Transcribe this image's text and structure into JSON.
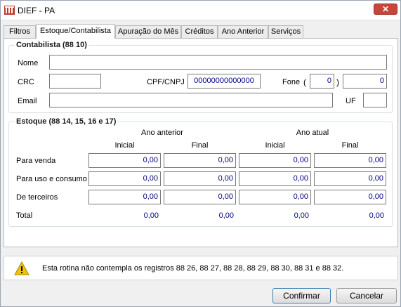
{
  "window": {
    "title": "DIEF - PA",
    "close_label": "✕"
  },
  "tabs": [
    {
      "label": "Filtros"
    },
    {
      "label": "Estoque/Contabilista"
    },
    {
      "label": "Apuração do Mês"
    },
    {
      "label": "Créditos"
    },
    {
      "label": "Ano Anterior"
    },
    {
      "label": "Serviços"
    }
  ],
  "active_tab": "Estoque/Contabilista",
  "contabilista": {
    "title": "Contabilista (88 10)",
    "nome_label": "Nome",
    "nome_value": "",
    "crc_label": "CRC",
    "crc_value": "",
    "cpf_label": "CPF/CNPJ",
    "cpf_value": "00000000000000",
    "fone_label": "Fone",
    "paren_open": "(",
    "paren_close": ")",
    "ddd_value": "0",
    "fone_value": "0",
    "email_label": "Email",
    "email_value": "",
    "uf_label": "UF",
    "uf_value": ""
  },
  "estoque": {
    "title": "Estoque (88 14, 15, 16 e 17)",
    "ano_anterior": "Ano anterior",
    "ano_atual": "Ano atual",
    "inicial": "Inicial",
    "final": "Final",
    "rows": [
      {
        "label": "Para venda",
        "values": [
          "0,00",
          "0,00",
          "0,00",
          "0,00"
        ]
      },
      {
        "label": "Para uso e consumo",
        "values": [
          "0,00",
          "0,00",
          "0,00",
          "0,00"
        ]
      },
      {
        "label": "De terceiros",
        "values": [
          "0,00",
          "0,00",
          "0,00",
          "0,00"
        ]
      }
    ],
    "total": {
      "label": "Total",
      "values": [
        "0,00",
        "0,00",
        "0,00",
        "0,00"
      ]
    }
  },
  "warning": {
    "text": "Esta rotina não contempla os registros 88 26, 88 27, 88 28, 88 29, 88 30, 88 31 e 88 32."
  },
  "buttons": {
    "confirm": "Confirmar",
    "cancel": "Cancelar"
  },
  "colors": {
    "value_text": "#000080",
    "close_button": "#c7463a",
    "warning_icon": "#f2c200"
  }
}
